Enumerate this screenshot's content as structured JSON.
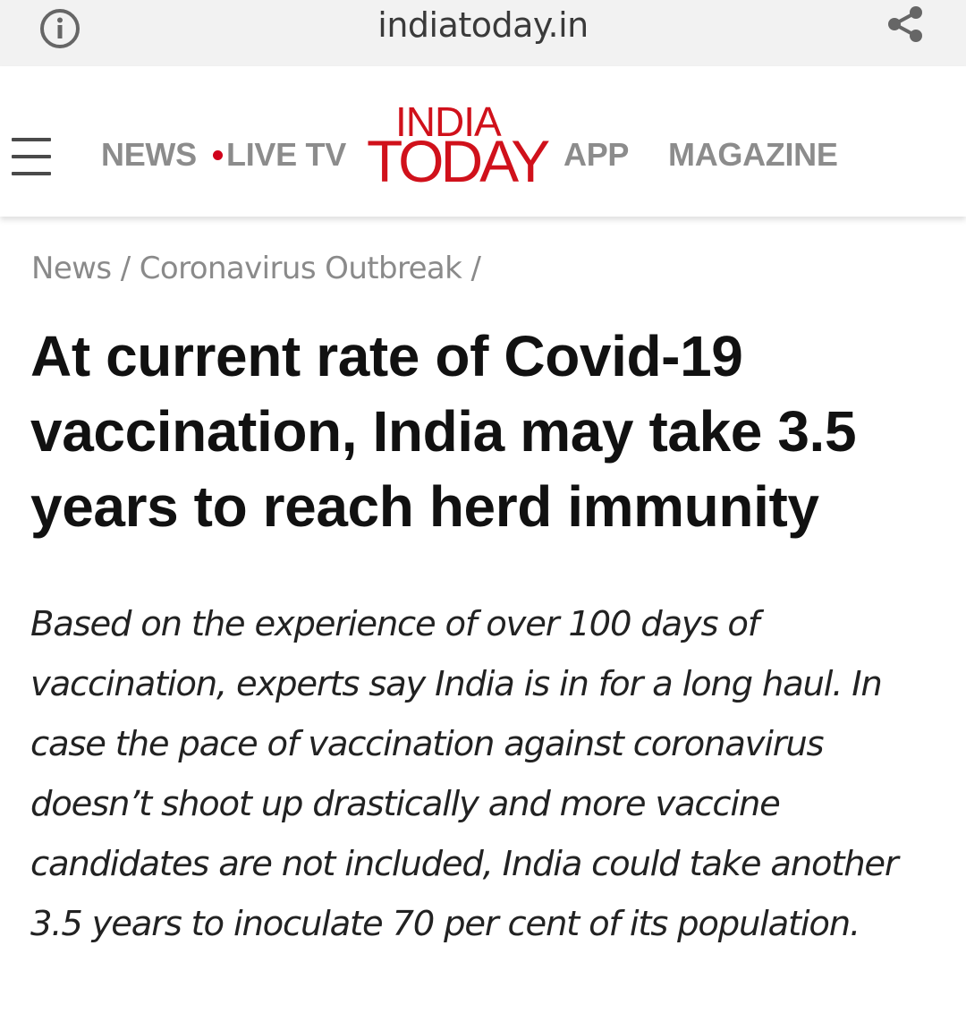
{
  "browser": {
    "url": "indiatoday.in",
    "info_icon": "info-icon",
    "share_icon": "share-icon"
  },
  "nav": {
    "menu_icon": "hamburger-menu-icon",
    "items": [
      {
        "label": "NEWS"
      },
      {
        "label": "LIVE TV"
      },
      {
        "label": "APP"
      },
      {
        "label": "MAGAZINE"
      }
    ],
    "logo_top": "INDIA",
    "logo_bottom": "TODAY",
    "live_dot_color": "#d0021b",
    "brand_color": "#d0111b"
  },
  "breadcrumb": {
    "items": [
      "News",
      "Coronavirus Outbreak"
    ],
    "separator": "/"
  },
  "article": {
    "headline": "At current rate of Covid-19 vaccination, India may take 3.5 years to reach herd immunity",
    "summary": "Based on the experience of over 100 days of vaccination, experts say India is in for a long haul. In case the pace of vaccination against coronavirus doesn’t shoot up drastically and more vaccine candidates are not included, India could take another 3.5 years to inoculate 70 per cent of its population."
  }
}
